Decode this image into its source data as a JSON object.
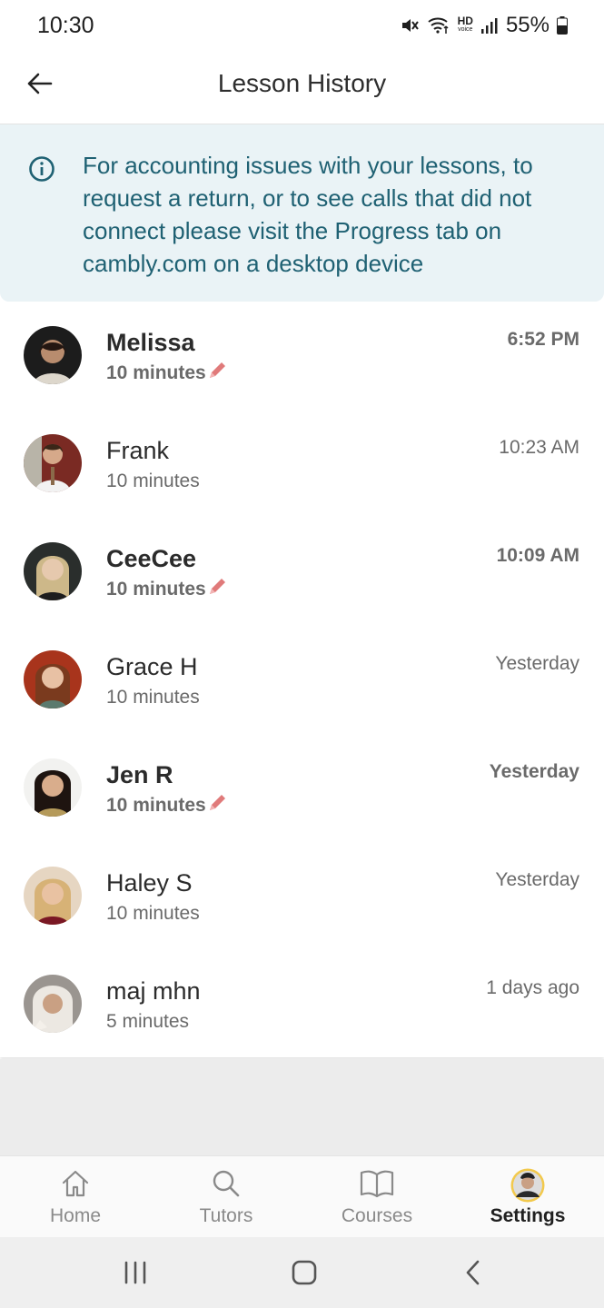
{
  "status_bar": {
    "time": "10:30",
    "battery": "55%"
  },
  "header": {
    "title": "Lesson History"
  },
  "banner": {
    "text": "For accounting issues with your lessons, to request a return, or to see calls that did not connect please visit the Progress tab on cambly.com on a desktop device"
  },
  "lessons": [
    {
      "name": "Melissa",
      "duration": "10 minutes",
      "time": "6:52 PM",
      "unread": true,
      "has_note": true
    },
    {
      "name": "Frank",
      "duration": "10 minutes",
      "time": "10:23 AM",
      "unread": false,
      "has_note": false
    },
    {
      "name": "CeeCee",
      "duration": "10 minutes",
      "time": "10:09 AM",
      "unread": true,
      "has_note": true
    },
    {
      "name": "Grace H",
      "duration": "10 minutes",
      "time": "Yesterday",
      "unread": false,
      "has_note": false
    },
    {
      "name": "Jen R",
      "duration": "10 minutes",
      "time": "Yesterday",
      "unread": true,
      "has_note": true
    },
    {
      "name": "Haley S",
      "duration": "10 minutes",
      "time": "Yesterday",
      "unread": false,
      "has_note": false
    },
    {
      "name": "maj mhn",
      "duration": "5 minutes",
      "time": "1 days ago",
      "unread": false,
      "has_note": false
    }
  ],
  "bottom_nav": {
    "items": [
      {
        "label": "Home",
        "icon": "home-icon"
      },
      {
        "label": "Tutors",
        "icon": "search-icon"
      },
      {
        "label": "Courses",
        "icon": "book-icon"
      },
      {
        "label": "Settings",
        "icon": "avatar",
        "active": true
      }
    ]
  },
  "colors": {
    "banner_bg": "#eaf3f6",
    "banner_text": "#1f6173",
    "note_pencil": "#e07a7a",
    "settings_ring": "#f2c94c"
  }
}
